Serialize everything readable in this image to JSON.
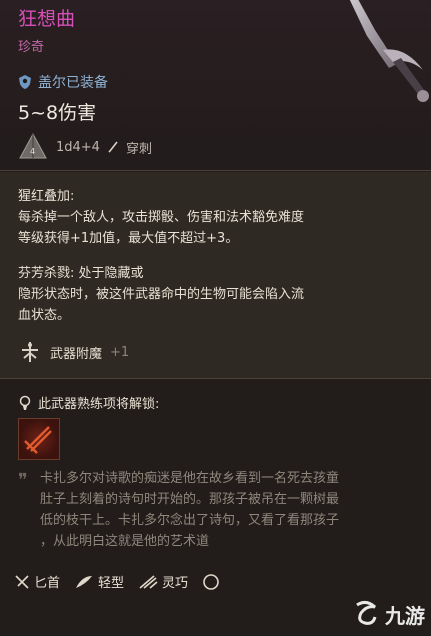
{
  "item": {
    "name": "狂想曲",
    "rarity": "珍奇",
    "equipped_status": "盖尔已装备",
    "damage": "5~8伤害",
    "dice": "1d4+4",
    "damage_type": "穿刺"
  },
  "effects": {
    "crimson_title": "猩红叠加:",
    "crimson_desc_1": "每杀掉一个敌人，攻击掷骰、伤害和法术豁免难度",
    "crimson_desc_2": "等级获得+1加值，最大值不超过+3。",
    "fragrant_title": "芬芳杀戮: 处于隐藏或",
    "fragrant_desc_1": "隐形状态时，被这件武器命中的生物可能会陷入流",
    "fragrant_desc_2": "血状态。",
    "enchant_label": "武器附魔",
    "enchant_value": "+1"
  },
  "proficiency": {
    "header": "此武器熟练项将解锁:"
  },
  "lore": {
    "line_1": "卡扎多尔对诗歌的痴迷是他在故乡看到一名死去孩童",
    "line_2": "肚子上刻着的诗句时开始的。那孩子被吊在一颗树最",
    "line_3": "低的枝干上。卡扎多尔念出了诗句，又看了看那孩子",
    "line_4": "，从此明白这就是他的艺术道"
  },
  "footer": {
    "tags": [
      "匕首",
      "轻型",
      "灵巧"
    ]
  },
  "watermark": {
    "text": "九游"
  },
  "colors": {
    "title": "#d64fb8",
    "equipped": "#8fb2d4",
    "lore": "#8e877c"
  }
}
